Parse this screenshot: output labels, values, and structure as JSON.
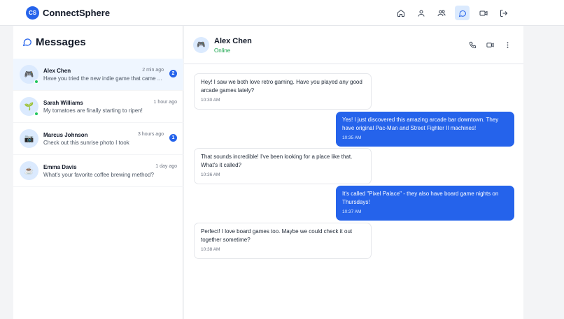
{
  "app": {
    "logo_initials": "CS",
    "name": "ConnectSphere"
  },
  "nav": [
    {
      "icon": "home-icon",
      "active": false
    },
    {
      "icon": "user-icon",
      "active": false
    },
    {
      "icon": "users-icon",
      "active": false
    },
    {
      "icon": "message-icon",
      "active": true
    },
    {
      "icon": "video-icon",
      "active": false
    },
    {
      "icon": "logout-icon",
      "active": false
    }
  ],
  "sidebar": {
    "title": "Messages",
    "conversations": [
      {
        "name": "Alex Chen",
        "time": "2 min ago",
        "preview": "Have you tried the new indie game that came ...",
        "unread": "2",
        "online": true,
        "avatar": "🎮",
        "selected": true
      },
      {
        "name": "Sarah Williams",
        "time": "1 hour ago",
        "preview": "My tomatoes are finally starting to ripen!",
        "online": true,
        "avatar": "🌱",
        "selected": false
      },
      {
        "name": "Marcus Johnson",
        "time": "3 hours ago",
        "preview": "Check out this sunrise photo I took",
        "unread": "1",
        "online": false,
        "avatar": "📷",
        "selected": false
      },
      {
        "name": "Emma Davis",
        "time": "1 day ago",
        "preview": "What's your favorite coffee brewing method?",
        "online": false,
        "avatar": "☕",
        "selected": false
      }
    ]
  },
  "chat": {
    "contact_name": "Alex Chen",
    "status": "Online",
    "avatar": "🎮",
    "messages": [
      {
        "direction": "in",
        "text": "Hey! I saw we both love retro gaming. Have you played any good arcade games lately?",
        "time": "10:30 AM"
      },
      {
        "direction": "out",
        "text": "Yes! I just discovered this amazing arcade bar downtown. They have original Pac-Man and Street Fighter II machines!",
        "time": "10:35 AM"
      },
      {
        "direction": "in",
        "text": "That sounds incredible! I've been looking for a place like that. What's it called?",
        "time": "10:36 AM"
      },
      {
        "direction": "out",
        "text": "It's called \"Pixel Palace\" - they also have board game nights on Thursdays!",
        "time": "10:37 AM"
      },
      {
        "direction": "in",
        "text": "Perfect! I love board games too. Maybe we could check it out together sometime?",
        "time": "10:38 AM"
      }
    ]
  },
  "colors": {
    "accent": "#2563eb",
    "online": "#22c55e",
    "status_text": "#16a34a"
  }
}
